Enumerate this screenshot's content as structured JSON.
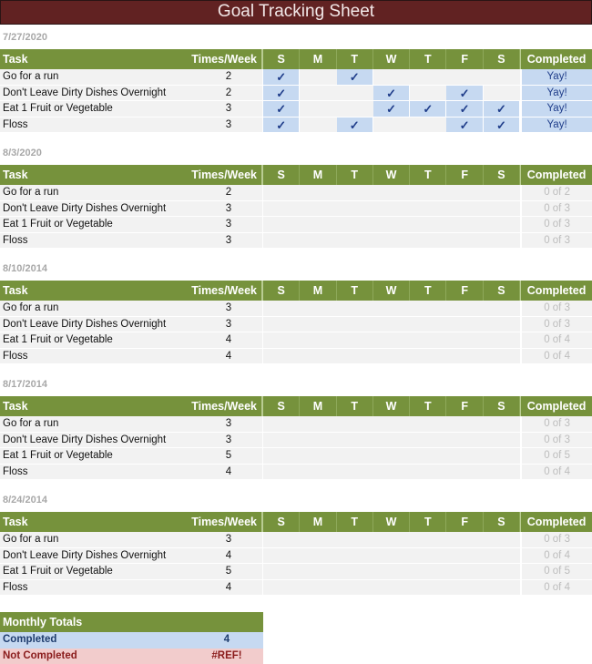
{
  "title": "Goal Tracking Sheet",
  "columns": {
    "task": "Task",
    "times_per_week": "Times/Week",
    "days": [
      "S",
      "M",
      "T",
      "W",
      "T",
      "F",
      "S"
    ],
    "completed": "Completed"
  },
  "check_glyph": "✓",
  "weeks": [
    {
      "date": "7/27/2020",
      "rows": [
        {
          "task": "Go for a run",
          "times": "2",
          "checks": [
            true,
            false,
            true,
            false,
            false,
            false,
            false
          ],
          "completed": "Yay!",
          "done": true
        },
        {
          "task": "Don't Leave Dirty Dishes Overnight",
          "times": "2",
          "checks": [
            true,
            false,
            false,
            true,
            false,
            true,
            false
          ],
          "completed": "Yay!",
          "done": true
        },
        {
          "task": "Eat 1 Fruit or Vegetable",
          "times": "3",
          "checks": [
            true,
            false,
            false,
            true,
            true,
            true,
            true
          ],
          "completed": "Yay!",
          "done": true
        },
        {
          "task": "Floss",
          "times": "3",
          "checks": [
            true,
            false,
            true,
            false,
            false,
            true,
            true
          ],
          "completed": "Yay!",
          "done": true
        }
      ]
    },
    {
      "date": "8/3/2020",
      "rows": [
        {
          "task": "Go for a run",
          "times": "2",
          "checks": [
            false,
            false,
            false,
            false,
            false,
            false,
            false
          ],
          "completed": "0 of 2",
          "done": false
        },
        {
          "task": "Don't Leave Dirty Dishes Overnight",
          "times": "3",
          "checks": [
            false,
            false,
            false,
            false,
            false,
            false,
            false
          ],
          "completed": "0 of 3",
          "done": false
        },
        {
          "task": "Eat 1 Fruit or Vegetable",
          "times": "3",
          "checks": [
            false,
            false,
            false,
            false,
            false,
            false,
            false
          ],
          "completed": "0 of 3",
          "done": false
        },
        {
          "task": "Floss",
          "times": "3",
          "checks": [
            false,
            false,
            false,
            false,
            false,
            false,
            false
          ],
          "completed": "0 of 3",
          "done": false
        }
      ]
    },
    {
      "date": "8/10/2014",
      "rows": [
        {
          "task": "Go for a run",
          "times": "3",
          "checks": [
            false,
            false,
            false,
            false,
            false,
            false,
            false
          ],
          "completed": "0 of 3",
          "done": false
        },
        {
          "task": "Don't Leave Dirty Dishes Overnight",
          "times": "3",
          "checks": [
            false,
            false,
            false,
            false,
            false,
            false,
            false
          ],
          "completed": "0 of 3",
          "done": false
        },
        {
          "task": "Eat 1 Fruit or Vegetable",
          "times": "4",
          "checks": [
            false,
            false,
            false,
            false,
            false,
            false,
            false
          ],
          "completed": "0 of 4",
          "done": false
        },
        {
          "task": "Floss",
          "times": "4",
          "checks": [
            false,
            false,
            false,
            false,
            false,
            false,
            false
          ],
          "completed": "0 of 4",
          "done": false
        }
      ]
    },
    {
      "date": "8/17/2014",
      "rows": [
        {
          "task": "Go for a run",
          "times": "3",
          "checks": [
            false,
            false,
            false,
            false,
            false,
            false,
            false
          ],
          "completed": "0 of 3",
          "done": false
        },
        {
          "task": "Don't Leave Dirty Dishes Overnight",
          "times": "3",
          "checks": [
            false,
            false,
            false,
            false,
            false,
            false,
            false
          ],
          "completed": "0 of 3",
          "done": false
        },
        {
          "task": "Eat 1 Fruit or Vegetable",
          "times": "5",
          "checks": [
            false,
            false,
            false,
            false,
            false,
            false,
            false
          ],
          "completed": "0 of 5",
          "done": false
        },
        {
          "task": "Floss",
          "times": "4",
          "checks": [
            false,
            false,
            false,
            false,
            false,
            false,
            false
          ],
          "completed": "0 of 4",
          "done": false
        }
      ]
    },
    {
      "date": "8/24/2014",
      "rows": [
        {
          "task": "Go for a run",
          "times": "3",
          "checks": [
            false,
            false,
            false,
            false,
            false,
            false,
            false
          ],
          "completed": "0 of 3",
          "done": false
        },
        {
          "task": "Don't Leave Dirty Dishes Overnight",
          "times": "4",
          "checks": [
            false,
            false,
            false,
            false,
            false,
            false,
            false
          ],
          "completed": "0 of 4",
          "done": false
        },
        {
          "task": "Eat 1 Fruit or Vegetable",
          "times": "5",
          "checks": [
            false,
            false,
            false,
            false,
            false,
            false,
            false
          ],
          "completed": "0 of 5",
          "done": false
        },
        {
          "task": "Floss",
          "times": "4",
          "checks": [
            false,
            false,
            false,
            false,
            false,
            false,
            false
          ],
          "completed": "0 of 4",
          "done": false
        }
      ]
    }
  ],
  "monthly_totals": {
    "title": "Monthly Totals",
    "completed_label": "Completed",
    "completed_value": "4",
    "not_completed_label": "Not Completed",
    "not_completed_value": "#REF!"
  },
  "colors": {
    "title_bg": "#612222",
    "header_green": "#76923c",
    "check_blue_bg": "#c6d9f1",
    "row_gray": "#f2f2f2",
    "not_completed_bg": "#f2cccc"
  }
}
